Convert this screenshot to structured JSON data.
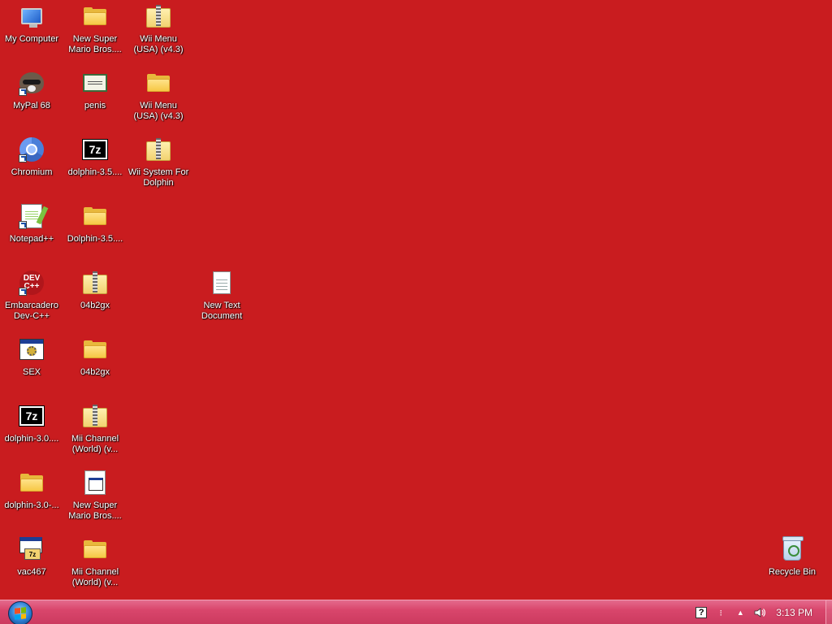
{
  "desktop": {
    "background_color": "#c91c1f",
    "icons": {
      "my_computer": "My Computer",
      "new_super_mario_folder": "New Super Mario Bros....",
      "wii_menu_zip": "Wii Menu (USA) (v4.3)",
      "mypal": "MyPal 68",
      "penis": "penis",
      "wii_menu_folder": "Wii Menu (USA) (v4.3)",
      "chromium": "Chromium",
      "dolphin35_7z": "dolphin-3.5....",
      "wii_system": "Wii System For Dolphin",
      "notepadpp": "Notepad++",
      "dolphin35_folder": "Dolphin-3.5....",
      "devcpp": "Embarcadero Dev-C++",
      "b04b2gx_zip": "04b2gx",
      "new_text_doc": "New Text Document",
      "sex": "SEX",
      "b04b2gx_folder": "04b2gx",
      "dolphin30_7z": "dolphin-3.0....",
      "mii_channel_zip": "Mii Channel (World) (v...",
      "dolphin30_folder": "dolphin-3.0-...",
      "new_super_mario_file": "New Super Mario Bros....",
      "vac467": "vac467",
      "mii_channel_folder": "Mii Channel (World) (v...",
      "recycle_bin": "Recycle Bin"
    },
    "glyphs": {
      "sevenz": "7z",
      "dev": "DEV\nC++",
      "vac_z": "7z"
    }
  },
  "taskbar": {
    "color": "#d9466c",
    "tray": {
      "help": "?",
      "clock": "3:13 PM"
    }
  }
}
